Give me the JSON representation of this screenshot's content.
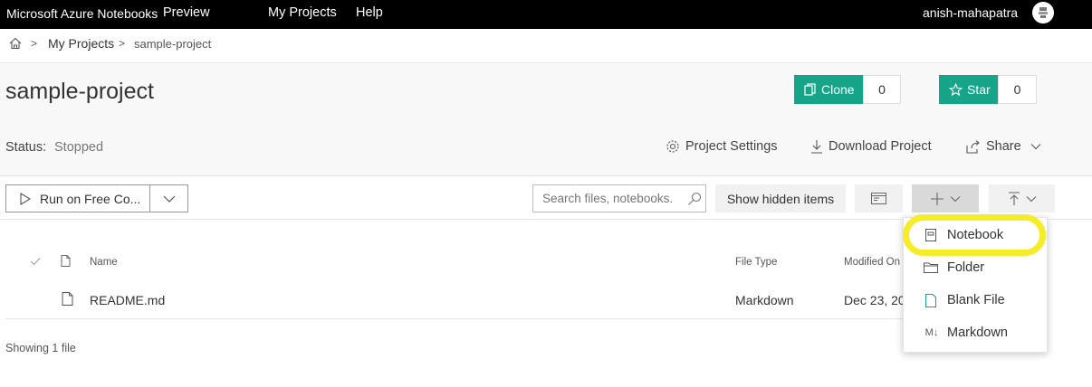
{
  "topbar": {
    "brand": "Microsoft Azure Notebooks",
    "preview": "Preview",
    "nav": [
      "My Projects",
      "Help"
    ],
    "user": "anish-mahapatra"
  },
  "breadcrumb": {
    "items": [
      "My Projects",
      "sample-project"
    ],
    "separator": ">"
  },
  "project": {
    "title": "sample-project",
    "status_label": "Status:",
    "status_value": "Stopped",
    "clone_label": "Clone",
    "clone_count": "0",
    "star_label": "Star",
    "star_count": "0",
    "settings_label": "Project Settings",
    "download_label": "Download Project",
    "share_label": "Share"
  },
  "toolbar": {
    "run_label": "Run on Free Co...",
    "search_placeholder": "Search files, notebooks.",
    "show_hidden_label": "Show hidden items"
  },
  "file_list": {
    "columns": [
      "Name",
      "File Type",
      "Modified On"
    ],
    "rows": [
      {
        "name": "README.md",
        "type": "Markdown",
        "modified": "Dec 23, 20"
      }
    ],
    "footer": "Showing 1 file"
  },
  "new_menu": {
    "items": [
      "Notebook",
      "Folder",
      "Blank File",
      "Markdown"
    ],
    "markdown_icon_text": "M↓"
  },
  "colors": {
    "accent": "#17a58a",
    "highlight": "#f5ec2a"
  }
}
